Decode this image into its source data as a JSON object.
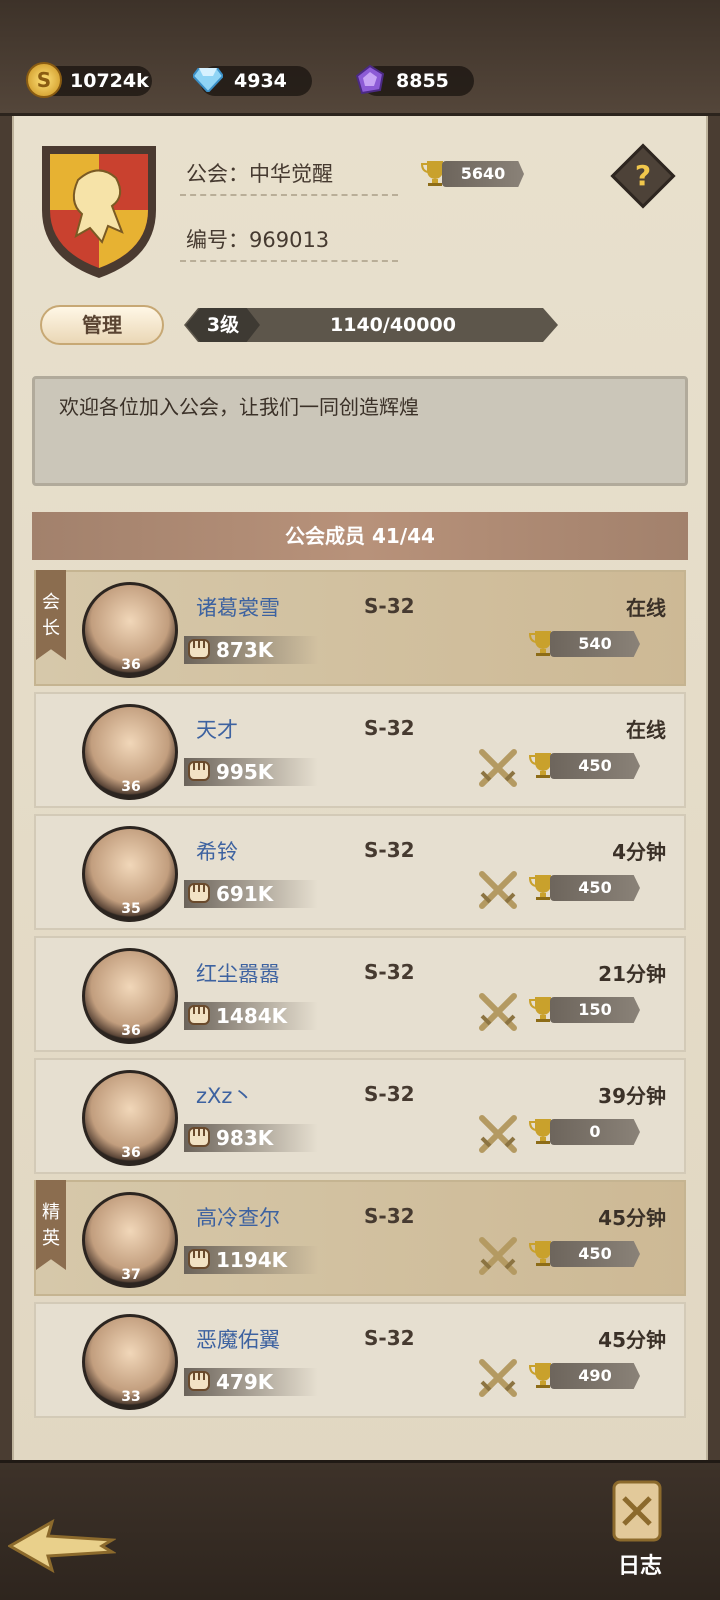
{
  "resources": [
    {
      "icon": "gold-coin-icon",
      "value": "10724k"
    },
    {
      "icon": "diamond-icon",
      "value": "4934"
    },
    {
      "icon": "purple-crystal-icon",
      "value": "8855"
    }
  ],
  "guild": {
    "name_label": "公会：中华觉醒",
    "id_label": "编号：969013",
    "trophies": "5640",
    "manage_label": "管理",
    "level_label": "3级",
    "exp": "1140/40000",
    "notice": "欢迎各位加入公会，让我们一同创造辉煌",
    "help_label": "?"
  },
  "members_header": "公会成员 41/44",
  "members": [
    {
      "name": "诸葛裳雪",
      "server": "S-32",
      "status": "在线",
      "level": "36",
      "power": "873K",
      "trophies": "540",
      "role": "会长",
      "highlight": true
    },
    {
      "name": "天才",
      "server": "S-32",
      "status": "在线",
      "level": "36",
      "power": "995K",
      "trophies": "450",
      "role": "",
      "highlight": false
    },
    {
      "name": "希铃",
      "server": "S-32",
      "status": "4分钟",
      "level": "35",
      "power": "691K",
      "trophies": "450",
      "role": "",
      "highlight": false
    },
    {
      "name": "红尘嚣嚣",
      "server": "S-32",
      "status": "21分钟",
      "level": "36",
      "power": "1484K",
      "trophies": "150",
      "role": "",
      "highlight": false
    },
    {
      "name": "zXz丶",
      "server": "S-32",
      "status": "39分钟",
      "level": "36",
      "power": "983K",
      "trophies": "0",
      "role": "",
      "highlight": false
    },
    {
      "name": "高冷查尔",
      "server": "S-32",
      "status": "45分钟",
      "level": "37",
      "power": "1194K",
      "trophies": "450",
      "role": "精英",
      "highlight": true
    },
    {
      "name": "恶魔佑翼",
      "server": "S-32",
      "status": "45分钟",
      "level": "33",
      "power": "479K",
      "trophies": "490",
      "role": "",
      "highlight": false
    }
  ],
  "bottom": {
    "log_label": "日志"
  }
}
